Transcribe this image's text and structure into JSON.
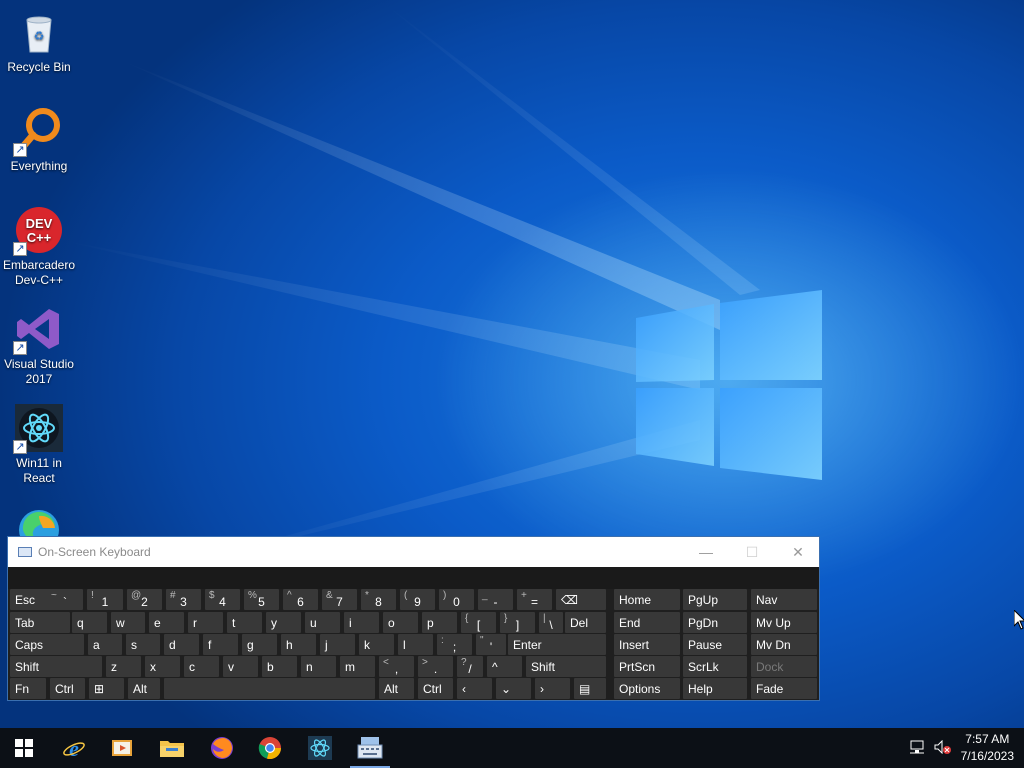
{
  "desktop": {
    "icons": [
      {
        "label": "Recycle Bin"
      },
      {
        "label": "Everything"
      },
      {
        "label": "Embarcadero Dev-C++",
        "img_text": "DEV C++"
      },
      {
        "label": "Visual Studio 2017"
      },
      {
        "label": "Win11 in React"
      }
    ]
  },
  "osk": {
    "title": "On-Screen Keyboard",
    "rows": [
      [
        {
          "label": "Esc"
        },
        {
          "up": "~",
          "main": "`"
        },
        {
          "up": "!",
          "main": "1"
        },
        {
          "up": "@",
          "main": "2"
        },
        {
          "up": "#",
          "main": "3"
        },
        {
          "up": "$",
          "main": "4"
        },
        {
          "up": "%",
          "main": "5"
        },
        {
          "up": "^",
          "main": "6"
        },
        {
          "up": "&",
          "main": "7"
        },
        {
          "up": "*",
          "main": "8"
        },
        {
          "up": "(",
          "main": "9"
        },
        {
          "up": ")",
          "main": "0"
        },
        {
          "up": "_",
          "main": "-"
        },
        {
          "up": "+",
          "main": "="
        },
        {
          "label": "⌫"
        }
      ],
      [
        {
          "label": "Tab"
        },
        {
          "label": "q"
        },
        {
          "label": "w"
        },
        {
          "label": "e"
        },
        {
          "label": "r"
        },
        {
          "label": "t"
        },
        {
          "label": "y"
        },
        {
          "label": "u"
        },
        {
          "label": "i"
        },
        {
          "label": "o"
        },
        {
          "label": "p"
        },
        {
          "up": "{",
          "main": "["
        },
        {
          "up": "}",
          "main": "]"
        },
        {
          "up": "|",
          "main": "\\"
        },
        {
          "label": "Del"
        }
      ],
      [
        {
          "label": "Caps"
        },
        {
          "label": "a"
        },
        {
          "label": "s"
        },
        {
          "label": "d"
        },
        {
          "label": "f"
        },
        {
          "label": "g"
        },
        {
          "label": "h"
        },
        {
          "label": "j"
        },
        {
          "label": "k"
        },
        {
          "label": "l"
        },
        {
          "up": ":",
          "main": ";"
        },
        {
          "up": "\"",
          "main": "'"
        },
        {
          "label": "Enter"
        }
      ],
      [
        {
          "label": "Shift"
        },
        {
          "label": "z"
        },
        {
          "label": "x"
        },
        {
          "label": "c"
        },
        {
          "label": "v"
        },
        {
          "label": "b"
        },
        {
          "label": "n"
        },
        {
          "label": "m"
        },
        {
          "up": "<",
          "main": ","
        },
        {
          "up": ">",
          "main": "."
        },
        {
          "up": "?",
          "main": "/"
        },
        {
          "label": "^"
        },
        {
          "label": "Shift"
        }
      ],
      [
        {
          "label": "Fn"
        },
        {
          "label": "Ctrl"
        },
        {
          "label": "⊞"
        },
        {
          "label": "Alt"
        },
        {
          "label": ""
        },
        {
          "label": "Alt"
        },
        {
          "label": "Ctrl"
        },
        {
          "label": "‹"
        },
        {
          "label": "⌄"
        },
        {
          "label": "›"
        },
        {
          "label": "▤"
        }
      ]
    ],
    "nav_keys": [
      [
        "Home",
        "PgUp",
        "Nav"
      ],
      [
        "End",
        "PgDn",
        "Mv Up"
      ],
      [
        "Insert",
        "Pause",
        "Mv Dn"
      ],
      [
        "PrtScn",
        "ScrLk",
        "Dock"
      ],
      [
        "Options",
        "Help",
        "Fade"
      ]
    ],
    "title_buttons": {
      "minimize": "—",
      "maximize": "☐",
      "close": "✕"
    }
  },
  "taskbar": {
    "apps": [
      "start",
      "internet-explorer",
      "media-player",
      "file-explorer",
      "firefox",
      "chrome",
      "win11-react",
      "on-screen-keyboard"
    ],
    "time": "7:57 AM",
    "date": "7/16/2023"
  }
}
